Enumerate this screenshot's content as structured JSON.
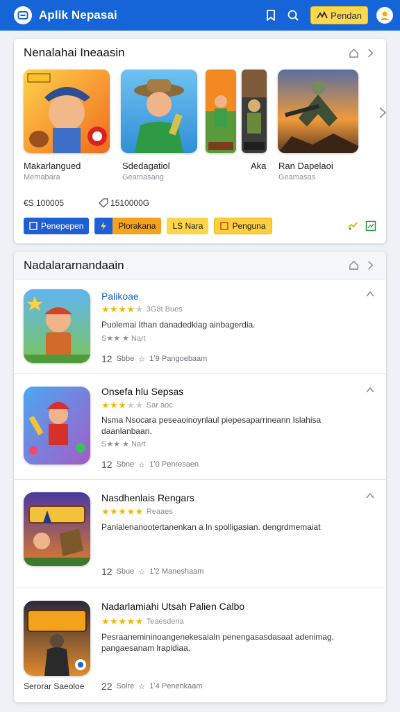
{
  "app": {
    "title": "Aplik Nepasai"
  },
  "topbar": {
    "login_label": "Pendan",
    "icons": [
      "bookmark-icon",
      "search-icon",
      "user-icon"
    ]
  },
  "featured": {
    "title": "Nenalahai Ineaasin",
    "apps": [
      {
        "label": "Makarlangued",
        "sub": "Memabara"
      },
      {
        "label": "Sdedagatiol",
        "sub": "Geamasang"
      },
      {
        "label": "Aka",
        "sub": ""
      },
      {
        "label": "Ran Dapelaoi",
        "sub": "Geamasas"
      }
    ],
    "stats": {
      "downloads": "€S 100005",
      "count": "1510000G"
    },
    "chips": [
      "Penepepen",
      "Plorakana",
      "LS Nara",
      "Penguna"
    ]
  },
  "list": {
    "title": "Nadalararnandaain",
    "items": [
      {
        "title": "Palikoae",
        "rating_text": "3G8t Bues",
        "stars": 4,
        "desc": "Puolemai Ithan danadedkiag ainbagerdia.",
        "sub": "S★★ ★ Nart",
        "foot_num": "12",
        "foot_a": "Sbbe",
        "foot_b": "1ʼ9 Pangoebaam"
      },
      {
        "title": "Onsefa hlu Sepsas",
        "rating_text": "Sar aoc",
        "stars": 3,
        "desc": "Nsma Nsocara peseaoinoynlaul piepesaparrineann Islahisa daanlanbaan.",
        "sub": "S★★ ★ Nart",
        "foot_num": "12",
        "foot_a": "Sbne",
        "foot_b": "1ʼ0 Penresaen"
      },
      {
        "title": "Nasdhenlais Rengars",
        "rating_text": "Reaaes",
        "stars": 5,
        "desc": "Panlalenanootertanenkan a ln spolligasian. dengrdmemaiat",
        "sub": "",
        "foot_num": "12",
        "foot_a": "Sbue",
        "foot_b": "1ʼ2 Maneshaam"
      },
      {
        "title": "Nadarlamiahi Utsah Palien Calbo",
        "rating_text": "Teaesdena",
        "stars": 5,
        "desc": "Pesraanemininoangenekesaialn penengasasdasaat adenimag. pangaesanam lrapidiaa.",
        "sub": "",
        "foot_num": "22",
        "foot_a": "Solre",
        "foot_b": "1ʼ4 Penenkaam",
        "left_label": "Serorar Saeoloe"
      }
    ]
  },
  "colors": {
    "brand": "#1565d8",
    "accent": "#ffd84a",
    "star": "#f5b800"
  }
}
